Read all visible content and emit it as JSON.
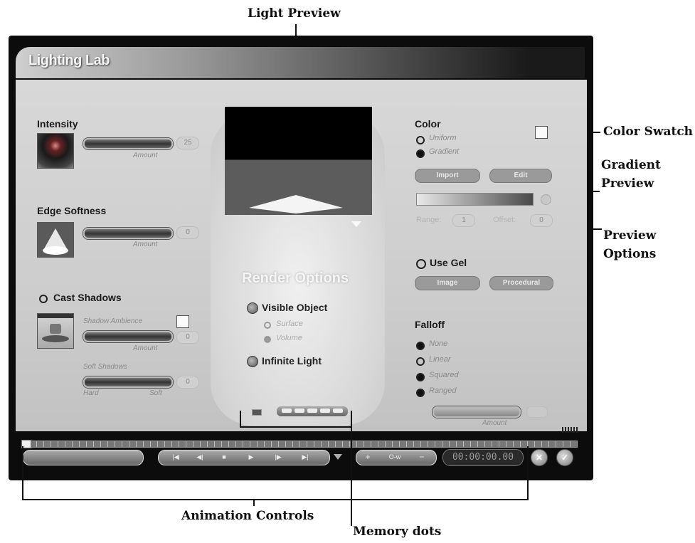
{
  "callouts": {
    "light_preview": "Light Preview",
    "color_swatch": "Color Swatch",
    "gradient_preview_line1": "Gradient",
    "gradient_preview_line2": "Preview",
    "preview_options_line1": "Preview",
    "preview_options_line2": "Options",
    "animation_controls": "Animation Controls",
    "memory_dots": "Memory dots"
  },
  "window": {
    "title": "Lighting Lab"
  },
  "intensity": {
    "heading": "Intensity",
    "slider_caption": "Amount",
    "value": "25"
  },
  "edge_softness": {
    "heading": "Edge Softness",
    "slider_caption": "Amount",
    "value": "0"
  },
  "cast_shadows": {
    "label": "Cast Shadows",
    "shadow_ambience": "Shadow Ambience",
    "ambience_caption": "Amount",
    "ambience_value": "0",
    "soft_shadows": "Soft Shadows",
    "hard": "Hard",
    "soft": "Soft",
    "soft_value": "0"
  },
  "render_options": {
    "heading": "Render Options",
    "visible_object": "Visible Object",
    "surface": "Surface",
    "volume": "Volume",
    "infinite_light": "Infinite Light"
  },
  "color": {
    "heading": "Color",
    "uniform": "Uniform",
    "gradient": "Gradient",
    "import_btn": "Import",
    "edit_btn": "Edit",
    "range_label": "Range:",
    "range_value": "1",
    "offset_label": "Offset:",
    "offset_value": "0"
  },
  "gel": {
    "label": "Use Gel",
    "image_btn": "Image",
    "procedural_btn": "Procedural"
  },
  "falloff": {
    "heading": "Falloff",
    "options": [
      "None",
      "Linear",
      "Squared",
      "Ranged"
    ],
    "slider_caption": "Amount"
  },
  "animation": {
    "timecode": "00:00:00.00",
    "plus": "+",
    "minus": "−",
    "key": "O-w"
  },
  "colors": {
    "preview_top": "#000000",
    "preview_bottom": "#5c5c5c",
    "panel": "#d0d0d0"
  }
}
